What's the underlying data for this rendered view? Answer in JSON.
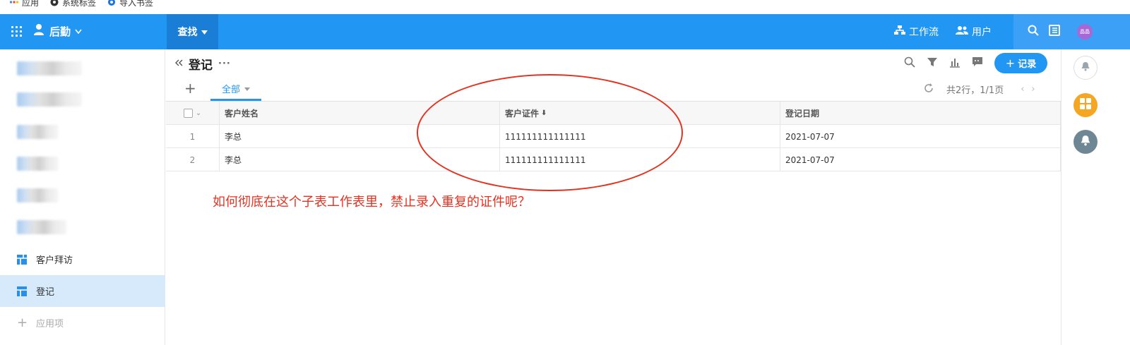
{
  "browser": {
    "bookmarks": [
      {
        "label": "应用",
        "icon": "apps-grid-icon"
      },
      {
        "label": "系统标签",
        "icon": "globe-icon"
      },
      {
        "label": "导入书签",
        "icon": "gear-icon"
      }
    ]
  },
  "header": {
    "app_name": "后勤",
    "search_tab": "查找",
    "workflow_label": "工作流",
    "users_label": "用户",
    "avatar_text": "晶晶",
    "accent": "#2196f3"
  },
  "sidebar": {
    "items": [
      {
        "label": "客户拜访",
        "icon": "dashboard-icon"
      },
      {
        "label": "登记",
        "icon": "table-icon",
        "active": true
      },
      {
        "label": "应用项",
        "icon": "plus-icon"
      }
    ]
  },
  "main": {
    "title": "登记",
    "add_button": "记录",
    "view_tab": "全部",
    "pager_text": "共2行，1/1页",
    "columns": [
      "客户姓名",
      "客户证件",
      "登记日期"
    ],
    "rows": [
      {
        "index": "1",
        "name": "李总",
        "id": "111111111111111",
        "date": "2021-07-07"
      },
      {
        "index": "2",
        "name": "李总",
        "id": "111111111111111",
        "date": "2021-07-07"
      }
    ]
  },
  "annotation": {
    "text": "如何彻底在这个子表工作表里，禁止录入重复的证件呢？",
    "color": "#e53220"
  }
}
